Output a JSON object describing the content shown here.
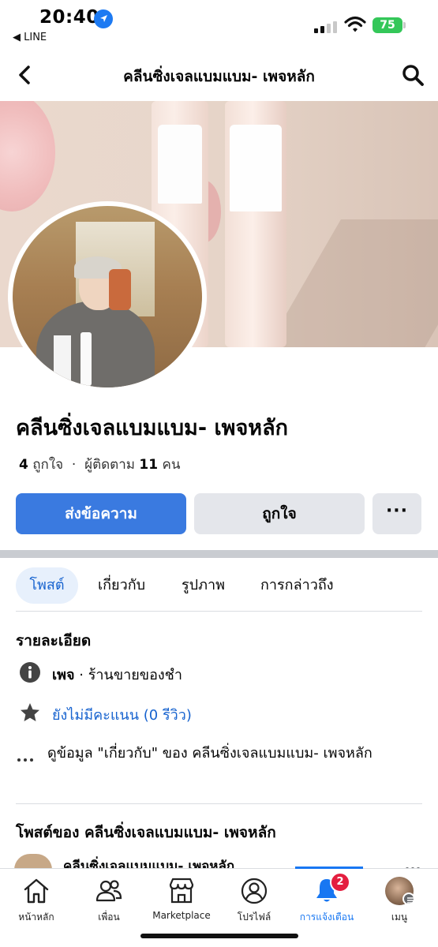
{
  "status_bar": {
    "time": "20:40",
    "back_app": "◀ LINE",
    "battery": "75"
  },
  "nav": {
    "title": "คลีนซิ่งเจลแบมแบม- เพจหลัก"
  },
  "page": {
    "name": "คลีนซิ่งเจลแบมแบม- เพจหลัก",
    "likes_count": "4",
    "likes_label": "ถูกใจ",
    "separator": "·",
    "followers_label": "ผู้ติดตาม",
    "followers_count": "11",
    "followers_unit": "คน"
  },
  "actions": {
    "message": "ส่งข้อความ",
    "like": "ถูกใจ",
    "more": "···"
  },
  "tabs": [
    {
      "label": "โพสต์",
      "active": true
    },
    {
      "label": "เกี่ยวกับ",
      "active": false
    },
    {
      "label": "รูปภาพ",
      "active": false
    },
    {
      "label": "การกล่าวถึง",
      "active": false
    }
  ],
  "details": {
    "title": "รายละเอียด",
    "category_bold": "เพจ",
    "category_rest": " · ร้านขายของชำ",
    "rating": "ยังไม่มีคะแนน (0 รีวิว)",
    "about": "ดูข้อมูล \"เกี่ยวกับ\" ของ คลีนซิ่งเจลแบมแบม- เพจหลัก"
  },
  "posts": {
    "title": "โพสต์ของ คลีนซิ่งเจลแบมแบม- เพจหลัก",
    "preview_name": "คลีนซิ่งเจลแบมแบม- เพจหลัก"
  },
  "tabbar": {
    "items": [
      {
        "label": "หน้าหลัก",
        "icon": "home-icon"
      },
      {
        "label": "เพื่อน",
        "icon": "friends-icon"
      },
      {
        "label": "Marketplace",
        "icon": "marketplace-icon"
      },
      {
        "label": "โปรไฟล์",
        "icon": "profile-icon"
      },
      {
        "label": "การแจ้งเตือน",
        "icon": "bell-icon"
      },
      {
        "label": "เมนู",
        "icon": "menu-avatar-icon"
      }
    ],
    "notification_badge": "2",
    "active_index": 4
  },
  "colors": {
    "accent": "#1877f2",
    "message_button": "#3a7ae0",
    "badge": "#e41e3f"
  }
}
